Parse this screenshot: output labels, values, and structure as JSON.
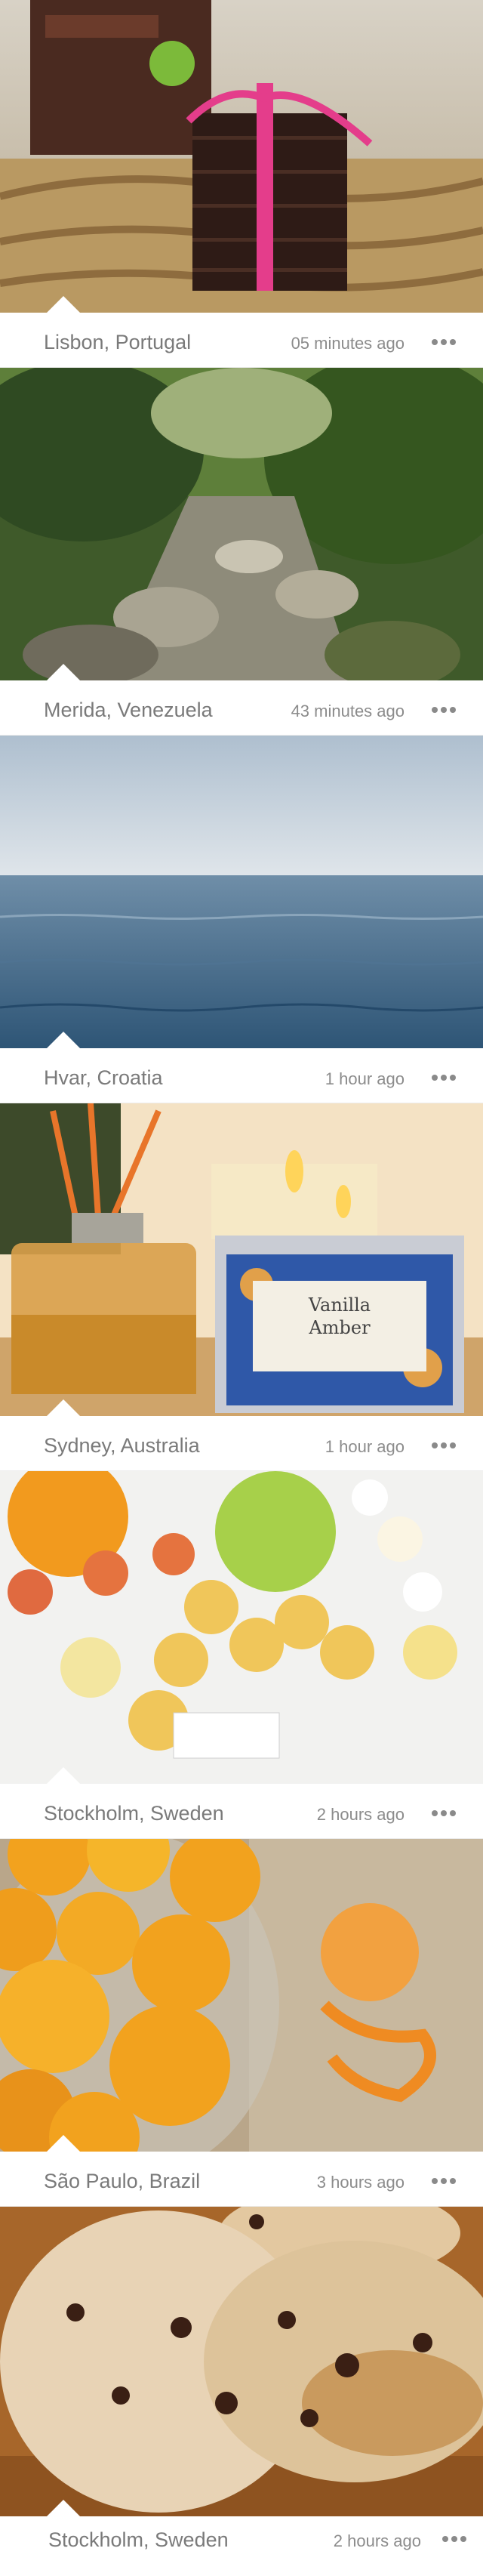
{
  "posts": [
    {
      "location": "Lisbon, Portugal",
      "time": "05 minutes ago",
      "photo": "chocolate-bar-stack-photo",
      "more_icon": "more-dots-icon"
    },
    {
      "location": "Merida, Venezuela",
      "time": "43 minutes ago",
      "photo": "forest-stream-photo",
      "more_icon": "more-dots-icon"
    },
    {
      "location": "Hvar, Croatia",
      "time": "1 hour ago",
      "photo": "sea-horizon-photo",
      "more_icon": "more-dots-icon"
    },
    {
      "location": "Sydney, Australia",
      "time": "1 hour ago",
      "photo": "candles-diffuser-photo",
      "more_icon": "more-dots-icon",
      "label_line1": "Vanilla",
      "label_line2": "Amber"
    },
    {
      "location": "Stockholm, Sweden",
      "time": "2 hours ago",
      "photo": "tealights-fruit-photo",
      "more_icon": "more-dots-icon"
    },
    {
      "location": "São Paulo, Brazil",
      "time": "3 hours ago",
      "photo": "oranges-peel-photo",
      "more_icon": "more-dots-icon"
    },
    {
      "location": "Stockholm, Sweden",
      "time": "2 hours ago",
      "photo": "cookies-photo",
      "more_icon": "more-dots-icon"
    }
  ]
}
